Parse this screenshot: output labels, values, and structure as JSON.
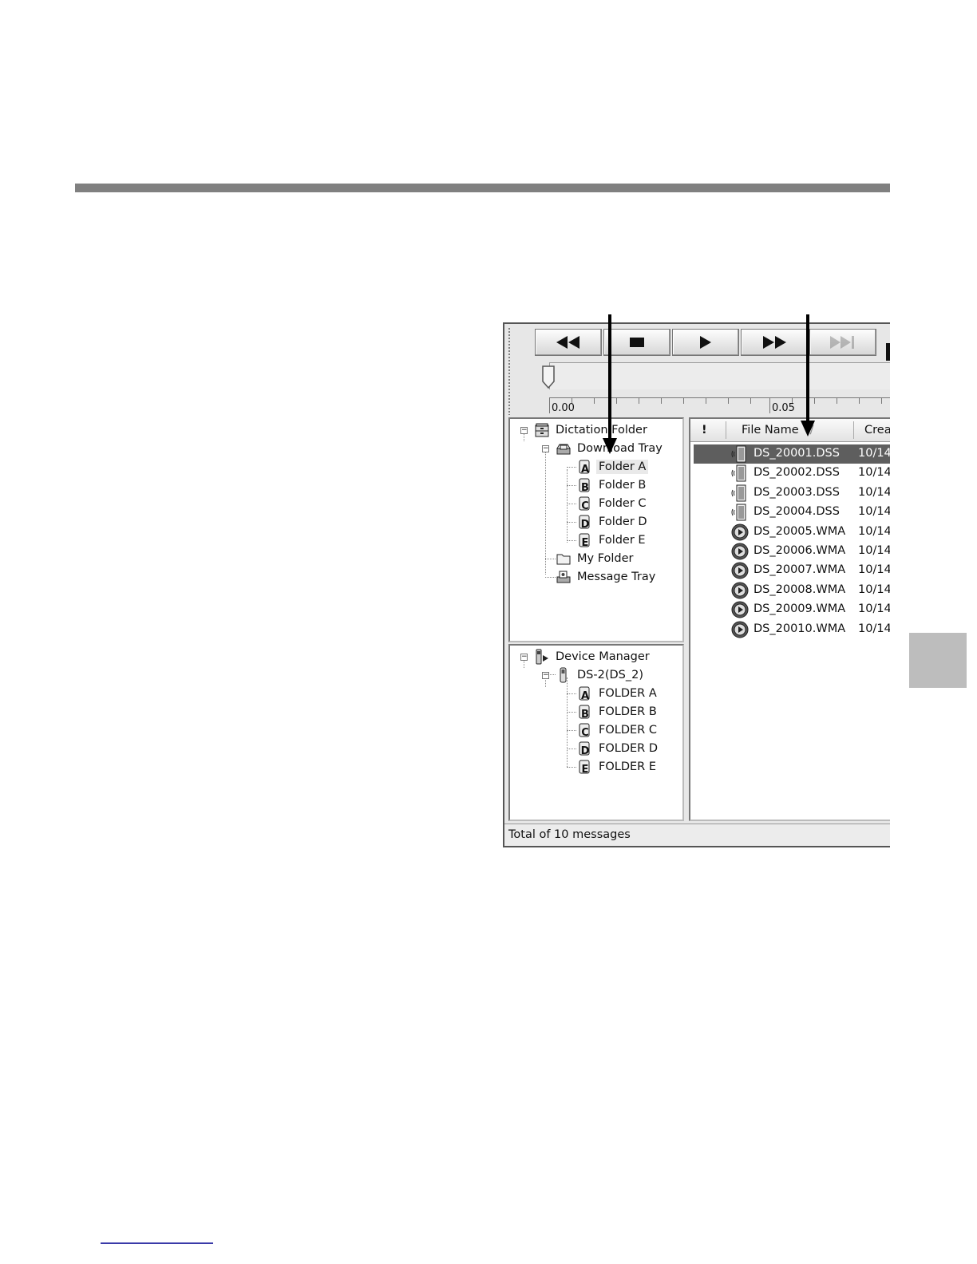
{
  "colors": {
    "rule": "#808080",
    "side_tab": "#bdbdbd",
    "selection": "#5e5e5e",
    "footer_line": "#3a3aa8"
  },
  "toolbar": {
    "buttons": [
      {
        "icon": "rewind-icon"
      },
      {
        "icon": "stop-icon"
      },
      {
        "icon": "play-icon"
      },
      {
        "icon": "fast-forward-icon"
      },
      {
        "icon": "skip-end-icon"
      }
    ]
  },
  "position": {
    "start_label": "0.00",
    "mid_label": "0.05"
  },
  "dictation_tree": {
    "root": "Dictation Folder",
    "download_tray": "Download Tray",
    "folders": [
      "Folder A",
      "Folder B",
      "Folder C",
      "Folder D",
      "Folder E"
    ],
    "folder_letters": [
      "A",
      "B",
      "C",
      "D",
      "E"
    ],
    "selected_folder": "Folder A",
    "my_folder": "My Folder",
    "message_tray": "Message Tray"
  },
  "device_tree": {
    "root": "Device Manager",
    "device": "DS-2(DS_2)",
    "folders": [
      "FOLDER A",
      "FOLDER B",
      "FOLDER C",
      "FOLDER D",
      "FOLDER E"
    ]
  },
  "file_list": {
    "columns": {
      "priority": "!",
      "file_name": "File Name",
      "sort_indicator": "/",
      "created": "Crea"
    },
    "files": [
      {
        "name": "DS_20001.DSS",
        "date": "10/14",
        "type": "dss-file-icon",
        "selected": true
      },
      {
        "name": "DS_20002.DSS",
        "date": "10/14",
        "type": "dss-file-icon"
      },
      {
        "name": "DS_20003.DSS",
        "date": "10/14",
        "type": "dss-file-icon"
      },
      {
        "name": "DS_20004.DSS",
        "date": "10/14",
        "type": "dss-file-icon"
      },
      {
        "name": "DS_20005.WMA",
        "date": "10/14",
        "type": "wma-file-icon"
      },
      {
        "name": "DS_20006.WMA",
        "date": "10/14",
        "type": "wma-file-icon"
      },
      {
        "name": "DS_20007.WMA",
        "date": "10/14",
        "type": "wma-file-icon"
      },
      {
        "name": "DS_20008.WMA",
        "date": "10/14",
        "type": "wma-file-icon"
      },
      {
        "name": "DS_20009.WMA",
        "date": "10/14",
        "type": "wma-file-icon"
      },
      {
        "name": "DS_20010.WMA",
        "date": "10/14",
        "type": "wma-file-icon"
      }
    ]
  },
  "status": {
    "text": "Total of 10 messages"
  }
}
